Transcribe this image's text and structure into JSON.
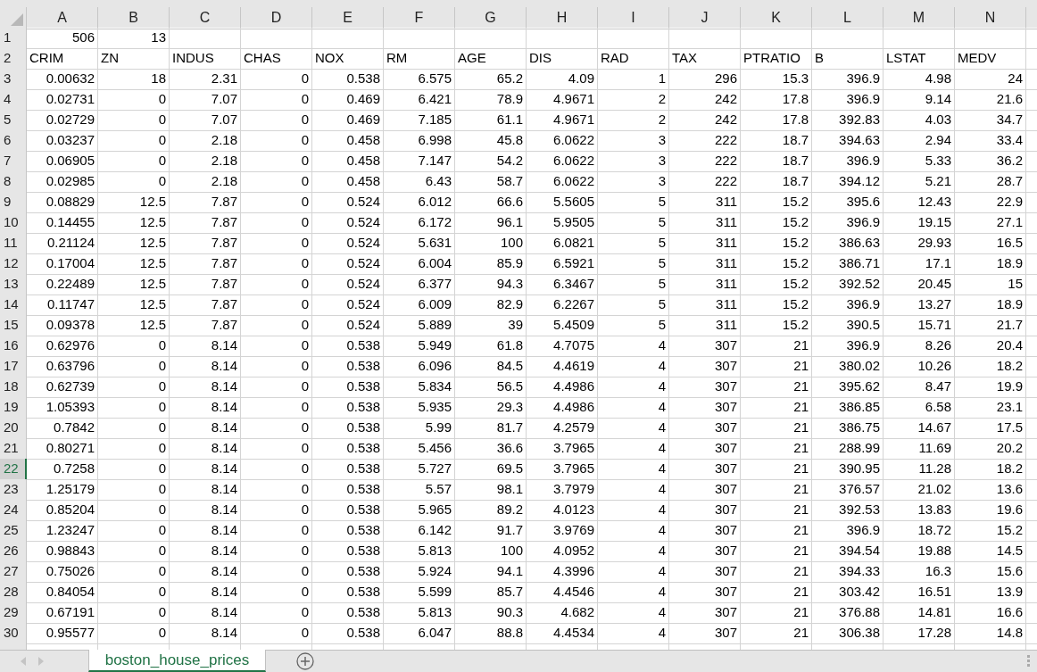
{
  "columns": [
    "A",
    "B",
    "C",
    "D",
    "E",
    "F",
    "G",
    "H",
    "I",
    "J",
    "K",
    "L",
    "M",
    "N"
  ],
  "rows": [
    {
      "number": "1",
      "kind": "numbers",
      "selected": false,
      "cells": [
        "506",
        "13"
      ]
    },
    {
      "number": "2",
      "kind": "labels",
      "selected": false,
      "cells": [
        "CRIM",
        "ZN",
        "INDUS",
        "CHAS",
        "NOX",
        "RM",
        "AGE",
        "DIS",
        "RAD",
        "TAX",
        "PTRATIO",
        "B",
        "LSTAT",
        "MEDV"
      ]
    },
    {
      "number": "3",
      "kind": "numbers",
      "selected": false,
      "cells": [
        "0.00632",
        "18",
        "2.31",
        "0",
        "0.538",
        "6.575",
        "65.2",
        "4.09",
        "1",
        "296",
        "15.3",
        "396.9",
        "4.98",
        "24"
      ]
    },
    {
      "number": "4",
      "kind": "numbers",
      "selected": false,
      "cells": [
        "0.02731",
        "0",
        "7.07",
        "0",
        "0.469",
        "6.421",
        "78.9",
        "4.9671",
        "2",
        "242",
        "17.8",
        "396.9",
        "9.14",
        "21.6"
      ]
    },
    {
      "number": "5",
      "kind": "numbers",
      "selected": false,
      "cells": [
        "0.02729",
        "0",
        "7.07",
        "0",
        "0.469",
        "7.185",
        "61.1",
        "4.9671",
        "2",
        "242",
        "17.8",
        "392.83",
        "4.03",
        "34.7"
      ]
    },
    {
      "number": "6",
      "kind": "numbers",
      "selected": false,
      "cells": [
        "0.03237",
        "0",
        "2.18",
        "0",
        "0.458",
        "6.998",
        "45.8",
        "6.0622",
        "3",
        "222",
        "18.7",
        "394.63",
        "2.94",
        "33.4"
      ]
    },
    {
      "number": "7",
      "kind": "numbers",
      "selected": false,
      "cells": [
        "0.06905",
        "0",
        "2.18",
        "0",
        "0.458",
        "7.147",
        "54.2",
        "6.0622",
        "3",
        "222",
        "18.7",
        "396.9",
        "5.33",
        "36.2"
      ]
    },
    {
      "number": "8",
      "kind": "numbers",
      "selected": false,
      "cells": [
        "0.02985",
        "0",
        "2.18",
        "0",
        "0.458",
        "6.43",
        "58.7",
        "6.0622",
        "3",
        "222",
        "18.7",
        "394.12",
        "5.21",
        "28.7"
      ]
    },
    {
      "number": "9",
      "kind": "numbers",
      "selected": false,
      "cells": [
        "0.08829",
        "12.5",
        "7.87",
        "0",
        "0.524",
        "6.012",
        "66.6",
        "5.5605",
        "5",
        "311",
        "15.2",
        "395.6",
        "12.43",
        "22.9"
      ]
    },
    {
      "number": "10",
      "kind": "numbers",
      "selected": false,
      "cells": [
        "0.14455",
        "12.5",
        "7.87",
        "0",
        "0.524",
        "6.172",
        "96.1",
        "5.9505",
        "5",
        "311",
        "15.2",
        "396.9",
        "19.15",
        "27.1"
      ]
    },
    {
      "number": "11",
      "kind": "numbers",
      "selected": false,
      "cells": [
        "0.21124",
        "12.5",
        "7.87",
        "0",
        "0.524",
        "5.631",
        "100",
        "6.0821",
        "5",
        "311",
        "15.2",
        "386.63",
        "29.93",
        "16.5"
      ]
    },
    {
      "number": "12",
      "kind": "numbers",
      "selected": false,
      "cells": [
        "0.17004",
        "12.5",
        "7.87",
        "0",
        "0.524",
        "6.004",
        "85.9",
        "6.5921",
        "5",
        "311",
        "15.2",
        "386.71",
        "17.1",
        "18.9"
      ]
    },
    {
      "number": "13",
      "kind": "numbers",
      "selected": false,
      "cells": [
        "0.22489",
        "12.5",
        "7.87",
        "0",
        "0.524",
        "6.377",
        "94.3",
        "6.3467",
        "5",
        "311",
        "15.2",
        "392.52",
        "20.45",
        "15"
      ]
    },
    {
      "number": "14",
      "kind": "numbers",
      "selected": false,
      "cells": [
        "0.11747",
        "12.5",
        "7.87",
        "0",
        "0.524",
        "6.009",
        "82.9",
        "6.2267",
        "5",
        "311",
        "15.2",
        "396.9",
        "13.27",
        "18.9"
      ]
    },
    {
      "number": "15",
      "kind": "numbers",
      "selected": false,
      "cells": [
        "0.09378",
        "12.5",
        "7.87",
        "0",
        "0.524",
        "5.889",
        "39",
        "5.4509",
        "5",
        "311",
        "15.2",
        "390.5",
        "15.71",
        "21.7"
      ]
    },
    {
      "number": "16",
      "kind": "numbers",
      "selected": false,
      "cells": [
        "0.62976",
        "0",
        "8.14",
        "0",
        "0.538",
        "5.949",
        "61.8",
        "4.7075",
        "4",
        "307",
        "21",
        "396.9",
        "8.26",
        "20.4"
      ]
    },
    {
      "number": "17",
      "kind": "numbers",
      "selected": false,
      "cells": [
        "0.63796",
        "0",
        "8.14",
        "0",
        "0.538",
        "6.096",
        "84.5",
        "4.4619",
        "4",
        "307",
        "21",
        "380.02",
        "10.26",
        "18.2"
      ]
    },
    {
      "number": "18",
      "kind": "numbers",
      "selected": false,
      "cells": [
        "0.62739",
        "0",
        "8.14",
        "0",
        "0.538",
        "5.834",
        "56.5",
        "4.4986",
        "4",
        "307",
        "21",
        "395.62",
        "8.47",
        "19.9"
      ]
    },
    {
      "number": "19",
      "kind": "numbers",
      "selected": false,
      "cells": [
        "1.05393",
        "0",
        "8.14",
        "0",
        "0.538",
        "5.935",
        "29.3",
        "4.4986",
        "4",
        "307",
        "21",
        "386.85",
        "6.58",
        "23.1"
      ]
    },
    {
      "number": "20",
      "kind": "numbers",
      "selected": false,
      "cells": [
        "0.7842",
        "0",
        "8.14",
        "0",
        "0.538",
        "5.99",
        "81.7",
        "4.2579",
        "4",
        "307",
        "21",
        "386.75",
        "14.67",
        "17.5"
      ]
    },
    {
      "number": "21",
      "kind": "numbers",
      "selected": false,
      "cells": [
        "0.80271",
        "0",
        "8.14",
        "0",
        "0.538",
        "5.456",
        "36.6",
        "3.7965",
        "4",
        "307",
        "21",
        "288.99",
        "11.69",
        "20.2"
      ]
    },
    {
      "number": "22",
      "kind": "numbers",
      "selected": true,
      "cells": [
        "0.7258",
        "0",
        "8.14",
        "0",
        "0.538",
        "5.727",
        "69.5",
        "3.7965",
        "4",
        "307",
        "21",
        "390.95",
        "11.28",
        "18.2"
      ]
    },
    {
      "number": "23",
      "kind": "numbers",
      "selected": false,
      "cells": [
        "1.25179",
        "0",
        "8.14",
        "0",
        "0.538",
        "5.57",
        "98.1",
        "3.7979",
        "4",
        "307",
        "21",
        "376.57",
        "21.02",
        "13.6"
      ]
    },
    {
      "number": "24",
      "kind": "numbers",
      "selected": false,
      "cells": [
        "0.85204",
        "0",
        "8.14",
        "0",
        "0.538",
        "5.965",
        "89.2",
        "4.0123",
        "4",
        "307",
        "21",
        "392.53",
        "13.83",
        "19.6"
      ]
    },
    {
      "number": "25",
      "kind": "numbers",
      "selected": false,
      "cells": [
        "1.23247",
        "0",
        "8.14",
        "0",
        "0.538",
        "6.142",
        "91.7",
        "3.9769",
        "4",
        "307",
        "21",
        "396.9",
        "18.72",
        "15.2"
      ]
    },
    {
      "number": "26",
      "kind": "numbers",
      "selected": false,
      "cells": [
        "0.98843",
        "0",
        "8.14",
        "0",
        "0.538",
        "5.813",
        "100",
        "4.0952",
        "4",
        "307",
        "21",
        "394.54",
        "19.88",
        "14.5"
      ]
    },
    {
      "number": "27",
      "kind": "numbers",
      "selected": false,
      "cells": [
        "0.75026",
        "0",
        "8.14",
        "0",
        "0.538",
        "5.924",
        "94.1",
        "4.3996",
        "4",
        "307",
        "21",
        "394.33",
        "16.3",
        "15.6"
      ]
    },
    {
      "number": "28",
      "kind": "numbers",
      "selected": false,
      "cells": [
        "0.84054",
        "0",
        "8.14",
        "0",
        "0.538",
        "5.599",
        "85.7",
        "4.4546",
        "4",
        "307",
        "21",
        "303.42",
        "16.51",
        "13.9"
      ]
    },
    {
      "number": "29",
      "kind": "numbers",
      "selected": false,
      "cells": [
        "0.67191",
        "0",
        "8.14",
        "0",
        "0.538",
        "5.813",
        "90.3",
        "4.682",
        "4",
        "307",
        "21",
        "376.88",
        "14.81",
        "16.6"
      ]
    },
    {
      "number": "30",
      "kind": "numbers",
      "selected": false,
      "cells": [
        "0.95577",
        "0",
        "8.14",
        "0",
        "0.538",
        "6.047",
        "88.8",
        "4.4534",
        "4",
        "307",
        "21",
        "306.38",
        "17.28",
        "14.8"
      ]
    }
  ],
  "sheet_tabs": [
    {
      "label": "boston_house_prices",
      "selected": true
    }
  ]
}
